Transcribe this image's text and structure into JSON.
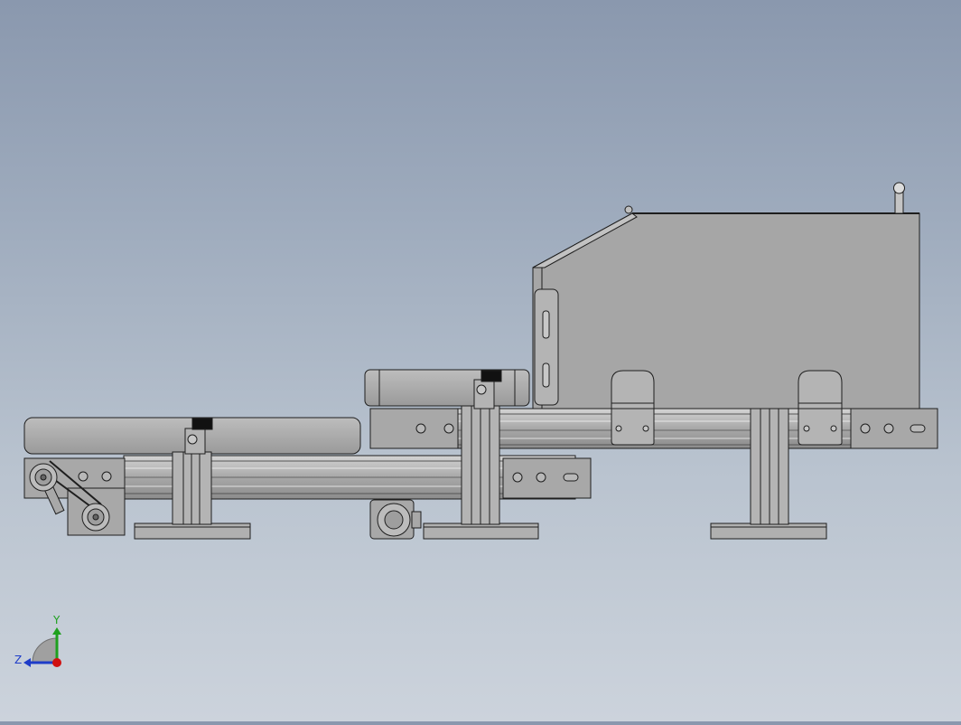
{
  "viewport": {
    "background_top": "#8a98ae",
    "background_bottom": "#ccd3dc",
    "part_color": "#a6a6a6",
    "edge_color": "#1e1e1e"
  },
  "triad": {
    "y_label": "Y",
    "z_label": "Z",
    "y_color": "#1ea01e",
    "z_color": "#1e3cc8",
    "x_color": "#d01010"
  }
}
